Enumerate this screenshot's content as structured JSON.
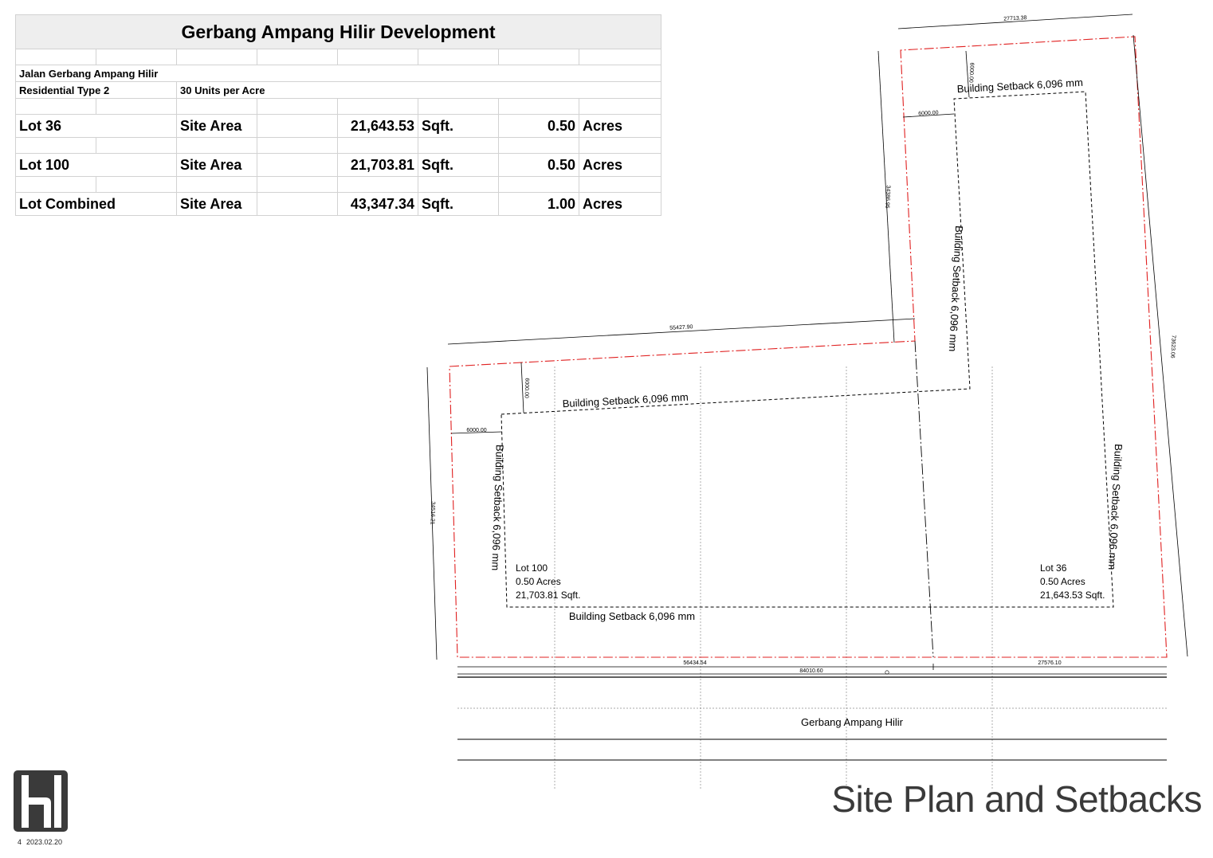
{
  "table": {
    "title": "Gerbang Ampang Hilir Development",
    "road": "Jalan Gerbang Ampang Hilir",
    "zoning": "Residential Type 2",
    "density": "30 Units per Acre",
    "rows": [
      {
        "lot": "Lot 36",
        "label": "Site Area",
        "sqft": "21,643.53",
        "sqft_unit": "Sqft.",
        "acres": "0.50",
        "acres_unit": "Acres"
      },
      {
        "lot": "Lot 100",
        "label": "Site Area",
        "sqft": "21,703.81",
        "sqft_unit": "Sqft.",
        "acres": "0.50",
        "acres_unit": "Acres"
      },
      {
        "lot": "Lot Combined",
        "label": "Site Area",
        "sqft": "43,347.34",
        "sqft_unit": "Sqft.",
        "acres": "1.00",
        "acres_unit": "Acres"
      }
    ]
  },
  "plan": {
    "setback_label": "Building Setback 6,096 mm",
    "lot100": {
      "name": "Lot 100",
      "acres": "0.50 Acres",
      "sqft": "21,703.81 Sqft."
    },
    "lot36": {
      "name": "Lot 36",
      "acres": "0.50 Acres",
      "sqft": "21,643.53 Sqft."
    },
    "road_name": "Gerbang Ampang Hilir",
    "dims": {
      "top": "27713.38",
      "upper_left_vertical": "34386.95",
      "right_vertical": "73623.06",
      "left_horizontal": "55427.90",
      "left_vertical": "34516.21",
      "bottom_left": "56434.54",
      "bottom_right": "27576.10",
      "bottom_total": "84010.60",
      "setback_small_1": "6000.00",
      "setback_small_2": "6000.00",
      "setback_small_3": "6000.00",
      "setback_small_4": "6000.00"
    }
  },
  "sheet": {
    "title": "Site Plan and Setbacks",
    "page_number": "4",
    "date": "2023.02.20"
  },
  "colors": {
    "boundary": "#e02020",
    "lines": "#000000",
    "grid": "#9a9a9a",
    "title_band": "#eeeeee"
  }
}
